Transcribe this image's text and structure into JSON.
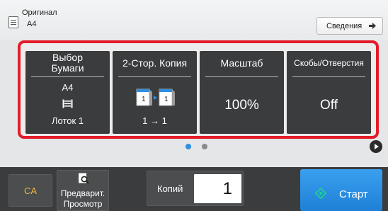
{
  "header": {
    "original_label": "Оригинал",
    "original_size": "A4",
    "details_button": "Сведения"
  },
  "tiles": {
    "paper": {
      "title": "Выбор\nБумаги",
      "size": "A4",
      "tray": "Лоток 1"
    },
    "duplex": {
      "title": "2-Стор. Копия",
      "mode": "1 → 1"
    },
    "scale": {
      "title": "Масштаб",
      "value": "100%"
    },
    "staple": {
      "title": "Скобы/Отверстия",
      "value": "Off"
    }
  },
  "pager": {
    "current_page": 1,
    "total_pages": 2
  },
  "bottom": {
    "ca_button": "CA",
    "preview_button": "Предварит.\nПросмотр",
    "copies_label": "Копий",
    "copies_value": "1",
    "start_button": "Старт"
  },
  "colors": {
    "highlight_frame": "#e41c2a",
    "tile_bg": "#3a3c3d",
    "start_button": "#2a8ee3",
    "ca_text": "#f2b63c",
    "active_dot": "#2f8fe0"
  },
  "icons": {
    "original": "document-icon",
    "details_arrow": "arrow-right-icon",
    "tray": "paper-tray-icon",
    "duplex": "duplex-copy-icon",
    "next_page": "play-icon",
    "preview": "magnifier-icon",
    "start": "start-diamond-icon"
  }
}
